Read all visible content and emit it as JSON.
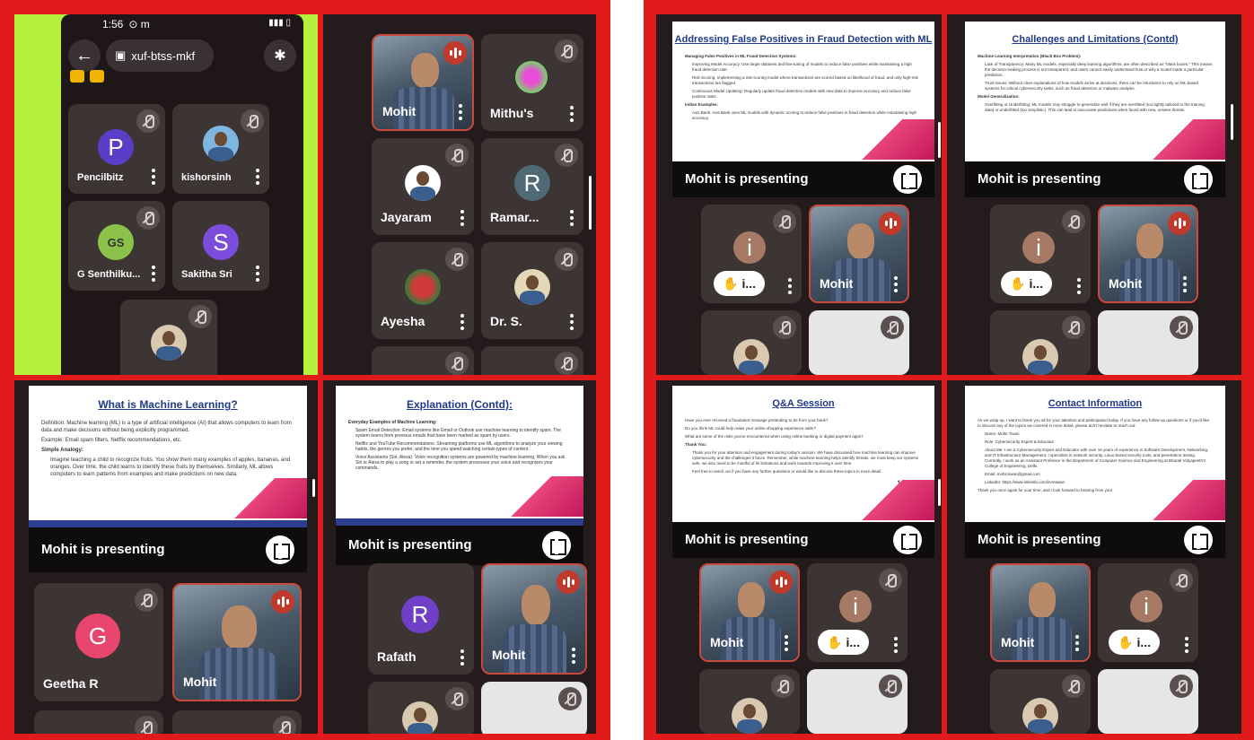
{
  "phone": {
    "status_time": "1:56",
    "status_icons": "⊙ m",
    "meeting_code": "xuf-btss-mkf",
    "participants": [
      {
        "name": "Pencilbitz",
        "initial": "P"
      },
      {
        "name": "kishorsinh"
      },
      {
        "name": "G Senthilku..."
      },
      {
        "name": "Sakitha Sri",
        "initial": "S"
      }
    ]
  },
  "panel_b": {
    "tiles": [
      {
        "name": "Mohit"
      },
      {
        "name": "Mithu's"
      },
      {
        "name": "Jayaram"
      },
      {
        "name": "Ramar...",
        "initial": "R"
      },
      {
        "name": "Ayesha"
      },
      {
        "name": "Dr. S."
      }
    ]
  },
  "panel_c": {
    "slide_title": "What is Machine Learning?",
    "slide_lines": [
      "Definition: Machine learning (ML) is a type of artificial intelligence (AI) that allows computers to learn from data and make decisions without being explicitly programmed.",
      "Example: Email spam filters, Netflix recommendations, etc.",
      "Simple Analogy:",
      "Imagine teaching a child to recognize fruits. You show them many examples of apples, bananas, and oranges. Over time, the child learns to identify these fruits by themselves. Similarly, ML allows computers to learn patterns from examples and make predictions on new data."
    ],
    "presenting": "Mohit is presenting",
    "tiles": [
      {
        "name": "Geetha R",
        "initial": "G"
      },
      {
        "name": "Mohit"
      }
    ]
  },
  "panel_d": {
    "slide_title": "Explanation (Contd):",
    "slide_lines": [
      "Everyday Examples of Machine Learning:",
      "Spam Email Detection: Email systems like Gmail or Outlook use machine learning to identify spam. The system learns from previous emails that have been marked as spam by users.",
      "Netflix and YouTube Recommendations: Streaming platforms use ML algorithms to analyze your viewing habits, the genres you prefer, and the time you spend watching certain types of content.",
      "Voice Assistants (Siri, Alexa): Voice recognition systems are powered by machine learning. When you ask Siri or Alexa to play a song or set a reminder, the system processes your voice and recognizes your commands."
    ],
    "presenting": "Mohit is presenting",
    "tiles": [
      {
        "name": "Rafath",
        "initial": "R"
      },
      {
        "name": "Mohit"
      }
    ]
  },
  "panel_e": {
    "slide_title": "Addressing False Positives in Fraud Detection with ML",
    "slide_lines": [
      "Managing False Positives in ML Fraud Detection Systems:",
      "Improving Model Accuracy: Use larger datasets and fine-tuning of models to reduce false positives while maintaining a high fraud detection rate.",
      "Risk Scoring: Implementing a risk-scoring model where transactions are scored based on likelihood of fraud, and only high-risk transactions are flagged.",
      "Continuous Model Updating: Regularly update fraud detection models with new data to improve accuracy and reduce false positive rates.",
      "Indian Examples:",
      "Axis Bank: Axis Bank uses ML models with dynamic scoring to reduce false positives in fraud detection while maintaining high accuracy."
    ],
    "presenting": "Mohit is presenting",
    "hand_label": "i...",
    "avatar_initial": "i",
    "mohit": "Mohit"
  },
  "panel_f": {
    "slide_title": "Challenges and Limitations (Contd)",
    "slide_lines": [
      "Machine Learning Interpretation (Black Box Problem):",
      "Lack of Transparency: Many ML models, especially deep learning algorithms, are often described as \"black boxes.\" This means the decision-making process is not transparent, and users cannot easily understand how or why a model made a particular prediction.",
      "Trust Issues: Without clear explanations of how models arrive at decisions, there can be reluctance to rely on ML-based systems for critical cybersecurity tasks, such as fraud detection or malware analysis.",
      "Model Generalization:",
      "Overfitting or Underfitting: ML models may struggle to generalize well if they are overfitted (too tightly tailored to the training data) or underfitted (too simplistic). This can lead to inaccurate predictions when faced with new, unseen threats."
    ],
    "presenting": "Mohit is presenting",
    "hand_label": "i...",
    "avatar_initial": "i",
    "mohit": "Mohit"
  },
  "panel_g": {
    "slide_title": "Q&A Session",
    "slide_lines": [
      "Have you ever received a fraudulent message pretending to be from your bank?",
      "Do you think ML could help make your online shopping experience safer?",
      "What are some of the risks you've encountered when using online banking or digital payment apps?",
      "Thank You:",
      "Thank you for your attention and engagement during today's session. We have discussed how machine learning can improve cybersecurity and the challenges it faces. Remember, while machine learning helps identify threats, we must keep our systems safe, we also need to be mindful of its limitations and work towards improving it over time.",
      "Feel free to reach out if you have any further questions or would like to discuss these topics in more detail."
    ],
    "page_num": "1",
    "presenting": "Mohit is presenting",
    "hand_label": "i...",
    "avatar_initial": "i",
    "mohit": "Mohit"
  },
  "panel_h": {
    "slide_title": "Contact Information",
    "slide_lines": [
      "As we wrap up, I want to thank you all for your attention and participation today. If you have any follow-up questions or if you'd like to discuss any of the topics we covered in more detail, please don't hesitate to reach out:",
      "Name: Mohit Tiwari",
      "Role: Cybersecurity Expert & Educator",
      "About Me: I am a Cybersecurity Expert and Educator with over 16 years of experience in Software Development, Networking, and IT Infrastructure Management. I specialize in network security, Linux-based security tools, and penetration testing. Currently, I work as an Assistant Professor in the Department of Computer Science and Engineering at Bharati Vidyapeeth's College of Engineering, Delhi.",
      "Email: mohit.tiwari@gmail.com",
      "LinkedIn: https://www.linkedin.com/in/mtiwari",
      "Thank you once again for your time, and I look forward to hearing from you!"
    ],
    "presenting": "Mohit is presenting",
    "hand_label": "i...",
    "avatar_initial": "i",
    "mohit": "Mohit"
  }
}
